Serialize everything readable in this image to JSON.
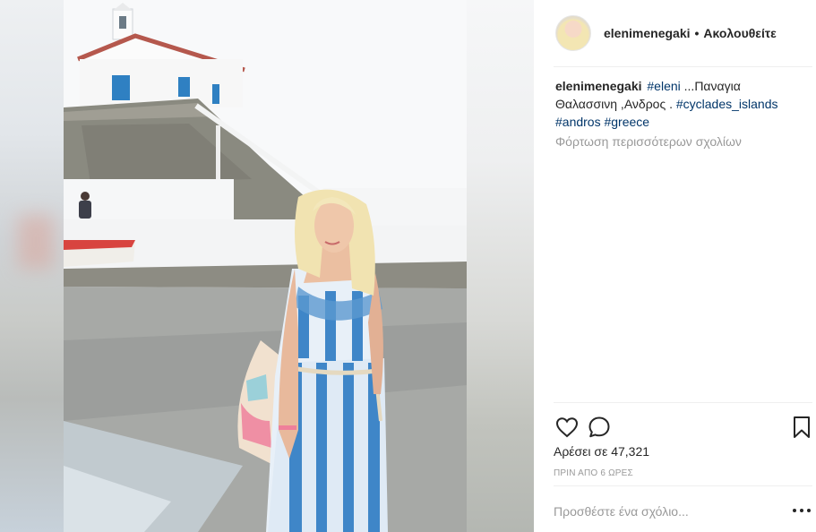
{
  "post": {
    "username": "elenimenegaki",
    "separator": "•",
    "follow_label": "Ακολουθείτε",
    "caption": {
      "username": "elenimenegaki",
      "tag_eleni": "#eleni",
      "text": " ...Παναγια Θαλασσινη ,Ανδρος . ",
      "tag_cyclades": "#cyclades_islands",
      "tag_andros": "#andros",
      "tag_greece": "#greece"
    },
    "load_more_comments": "Φόρτωση περισσότερων σχολίων",
    "likes_label": "Αρέσει σε",
    "likes_count": "47,321",
    "timestamp": "ΠΡΙΝ ΑΠΟ 6 ΩΡΕΣ",
    "comment_placeholder": "Προσθέστε ένα σχόλιο..."
  },
  "icons": {
    "like": "heart-icon",
    "comment": "comment-bubble-icon",
    "save": "bookmark-icon",
    "more": "more-options-icon"
  },
  "colors": {
    "text": "#262626",
    "hashtag": "#003569",
    "muted": "#999999",
    "divider": "#efefef"
  }
}
